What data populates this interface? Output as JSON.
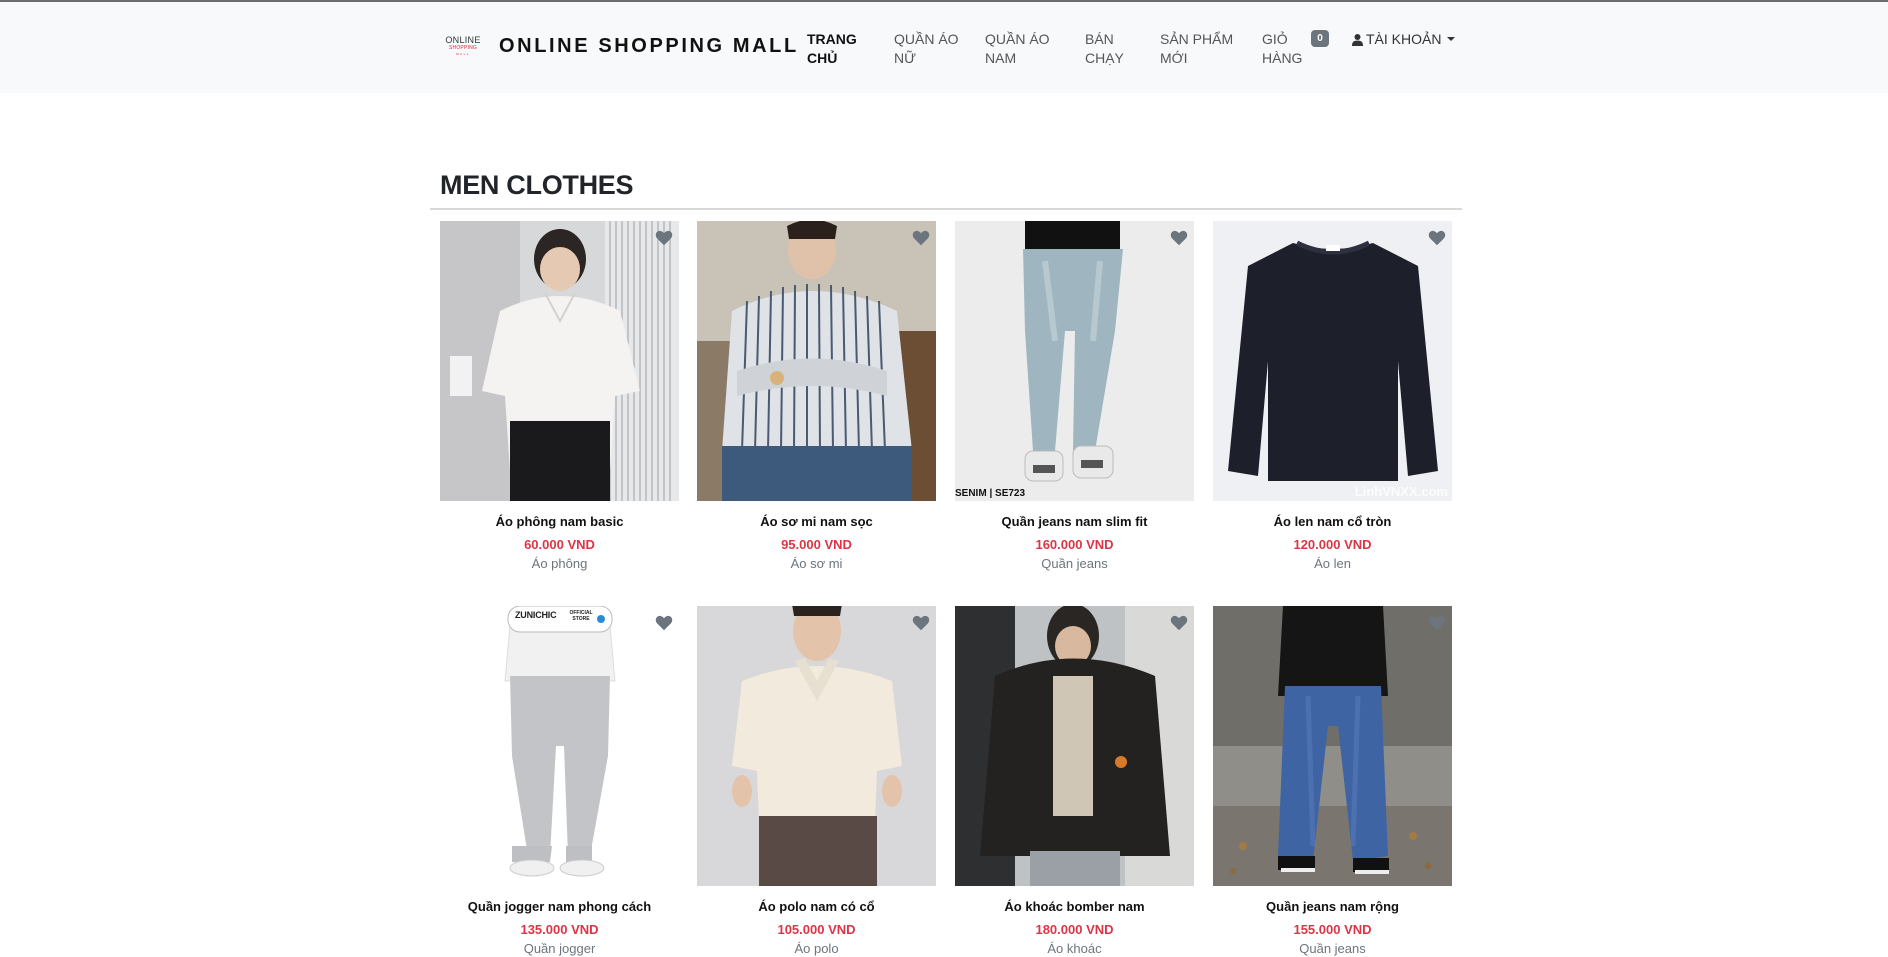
{
  "brand": {
    "logo_line1": "ONLINE",
    "logo_line2": "SHOPPING",
    "logo_line3": "MALL",
    "name": "ONLINE SHOPPING MALL"
  },
  "nav": {
    "items": [
      {
        "line1": "TRANG",
        "line2": "CHỦ",
        "active": true
      },
      {
        "line1": "QUẦN ÁO",
        "line2": "NỮ"
      },
      {
        "line1": "QUẦN ÁO",
        "line2": "NAM"
      },
      {
        "line1": "BÁN",
        "line2": "CHẠY"
      },
      {
        "line1": "SẢN PHẨM",
        "line2": "MỚI"
      },
      {
        "line1": "GIỎ",
        "line2": "HÀNG"
      }
    ],
    "cart_count": "0",
    "account_label": "TÀI KHOẢN"
  },
  "section": {
    "title": "MEN CLOTHES"
  },
  "products": [
    {
      "name": "Áo phông nam basic",
      "price": "60.000 VND",
      "category": "Áo phông"
    },
    {
      "name": "Áo sơ mi nam sọc",
      "price": "95.000 VND",
      "category": "Áo sơ mi"
    },
    {
      "name": "Quần jeans nam slim fit",
      "price": "160.000 VND",
      "category": "Quần jeans",
      "image_text": "SENIM | SE723"
    },
    {
      "name": "Áo len nam cổ tròn",
      "price": "120.000 VND",
      "category": "Áo len",
      "image_text": "LinhVNXX.com"
    },
    {
      "name": "Quần jogger nam phong cách",
      "price": "135.000 VND",
      "category": "Quần jogger",
      "image_text": "ZUNICHIC",
      "image_text2": "OFFICIAL STORE"
    },
    {
      "name": "Áo polo nam có cổ",
      "price": "105.000 VND",
      "category": "Áo polo"
    },
    {
      "name": "Áo khoác bomber nam",
      "price": "180.000 VND",
      "category": "Áo khoác"
    },
    {
      "name": "Quần jeans nam rộng",
      "price": "155.000 VND",
      "category": "Quần jeans"
    }
  ],
  "colors": {
    "price": "#dc3545",
    "heart": "#6c757d",
    "navbar": "#f8f9fa"
  }
}
